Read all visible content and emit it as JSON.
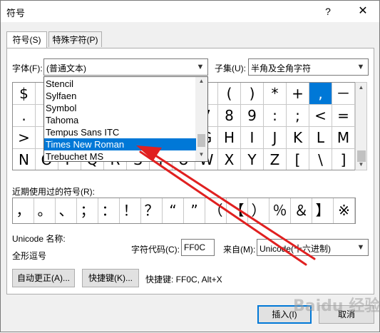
{
  "window": {
    "title": "符号",
    "help_glyph": "?",
    "close_glyph": "✕"
  },
  "tabs": [
    {
      "label": "符号(S)"
    },
    {
      "label": "特殊字符(P)"
    }
  ],
  "font": {
    "label": "字体(F):",
    "value": "(普通文本)"
  },
  "subset": {
    "label": "子集(U):",
    "value": "半角及全角字符"
  },
  "symbol_grid": {
    "rows": [
      [
        "$",
        "",
        "",
        "",
        "",
        "",
        "",
        "",
        "'",
        "(",
        ")",
        "*",
        "+",
        ",",
        "－"
      ],
      [
        ".",
        "",
        "",
        "",
        "",
        "",
        "",
        "",
        "7",
        "8",
        "9",
        ":",
        ";",
        "<",
        "="
      ],
      [
        ">",
        "",
        "",
        "",
        "",
        "",
        "",
        "",
        "G",
        "H",
        "I",
        "J",
        "K",
        "L",
        "M"
      ],
      [
        "N",
        "O",
        "P",
        "Q",
        "R",
        "S",
        "T",
        "U",
        "W",
        "X",
        "Y",
        "Z",
        "[",
        "\\",
        "]"
      ]
    ],
    "selected": ","
  },
  "font_dropdown": {
    "items": [
      "Stencil",
      "Sylfaen",
      "Symbol",
      "Tahoma",
      "Tempus Sans ITC",
      "Times New Roman",
      "Trebuchet MS"
    ],
    "selected": "Times New Roman"
  },
  "recent": {
    "label": "近期使用过的符号(R):",
    "symbols": [
      "，",
      "。",
      "、",
      "；",
      "：",
      "！",
      "？",
      "“",
      "”",
      "（",
      "【",
      "）",
      "％",
      "＆",
      "】",
      "※"
    ]
  },
  "unicode_name": {
    "label": "Unicode 名称:",
    "value": "全形逗号"
  },
  "char_code": {
    "label": "字符代码(C):",
    "value": "FF0C"
  },
  "from": {
    "label": "来自(M):",
    "value": "Unicode(十六进制)"
  },
  "buttons": {
    "autocorrect": "自动更正(A)...",
    "shortcut_key": "快捷键(K)...",
    "insert": "插入(I)",
    "cancel": "取消"
  },
  "shortcut_text": "快捷键: FF0C, Alt+X",
  "watermark": "Baidu 经验",
  "colors": {
    "accent": "#0078d7",
    "arrow": "#e02020"
  }
}
